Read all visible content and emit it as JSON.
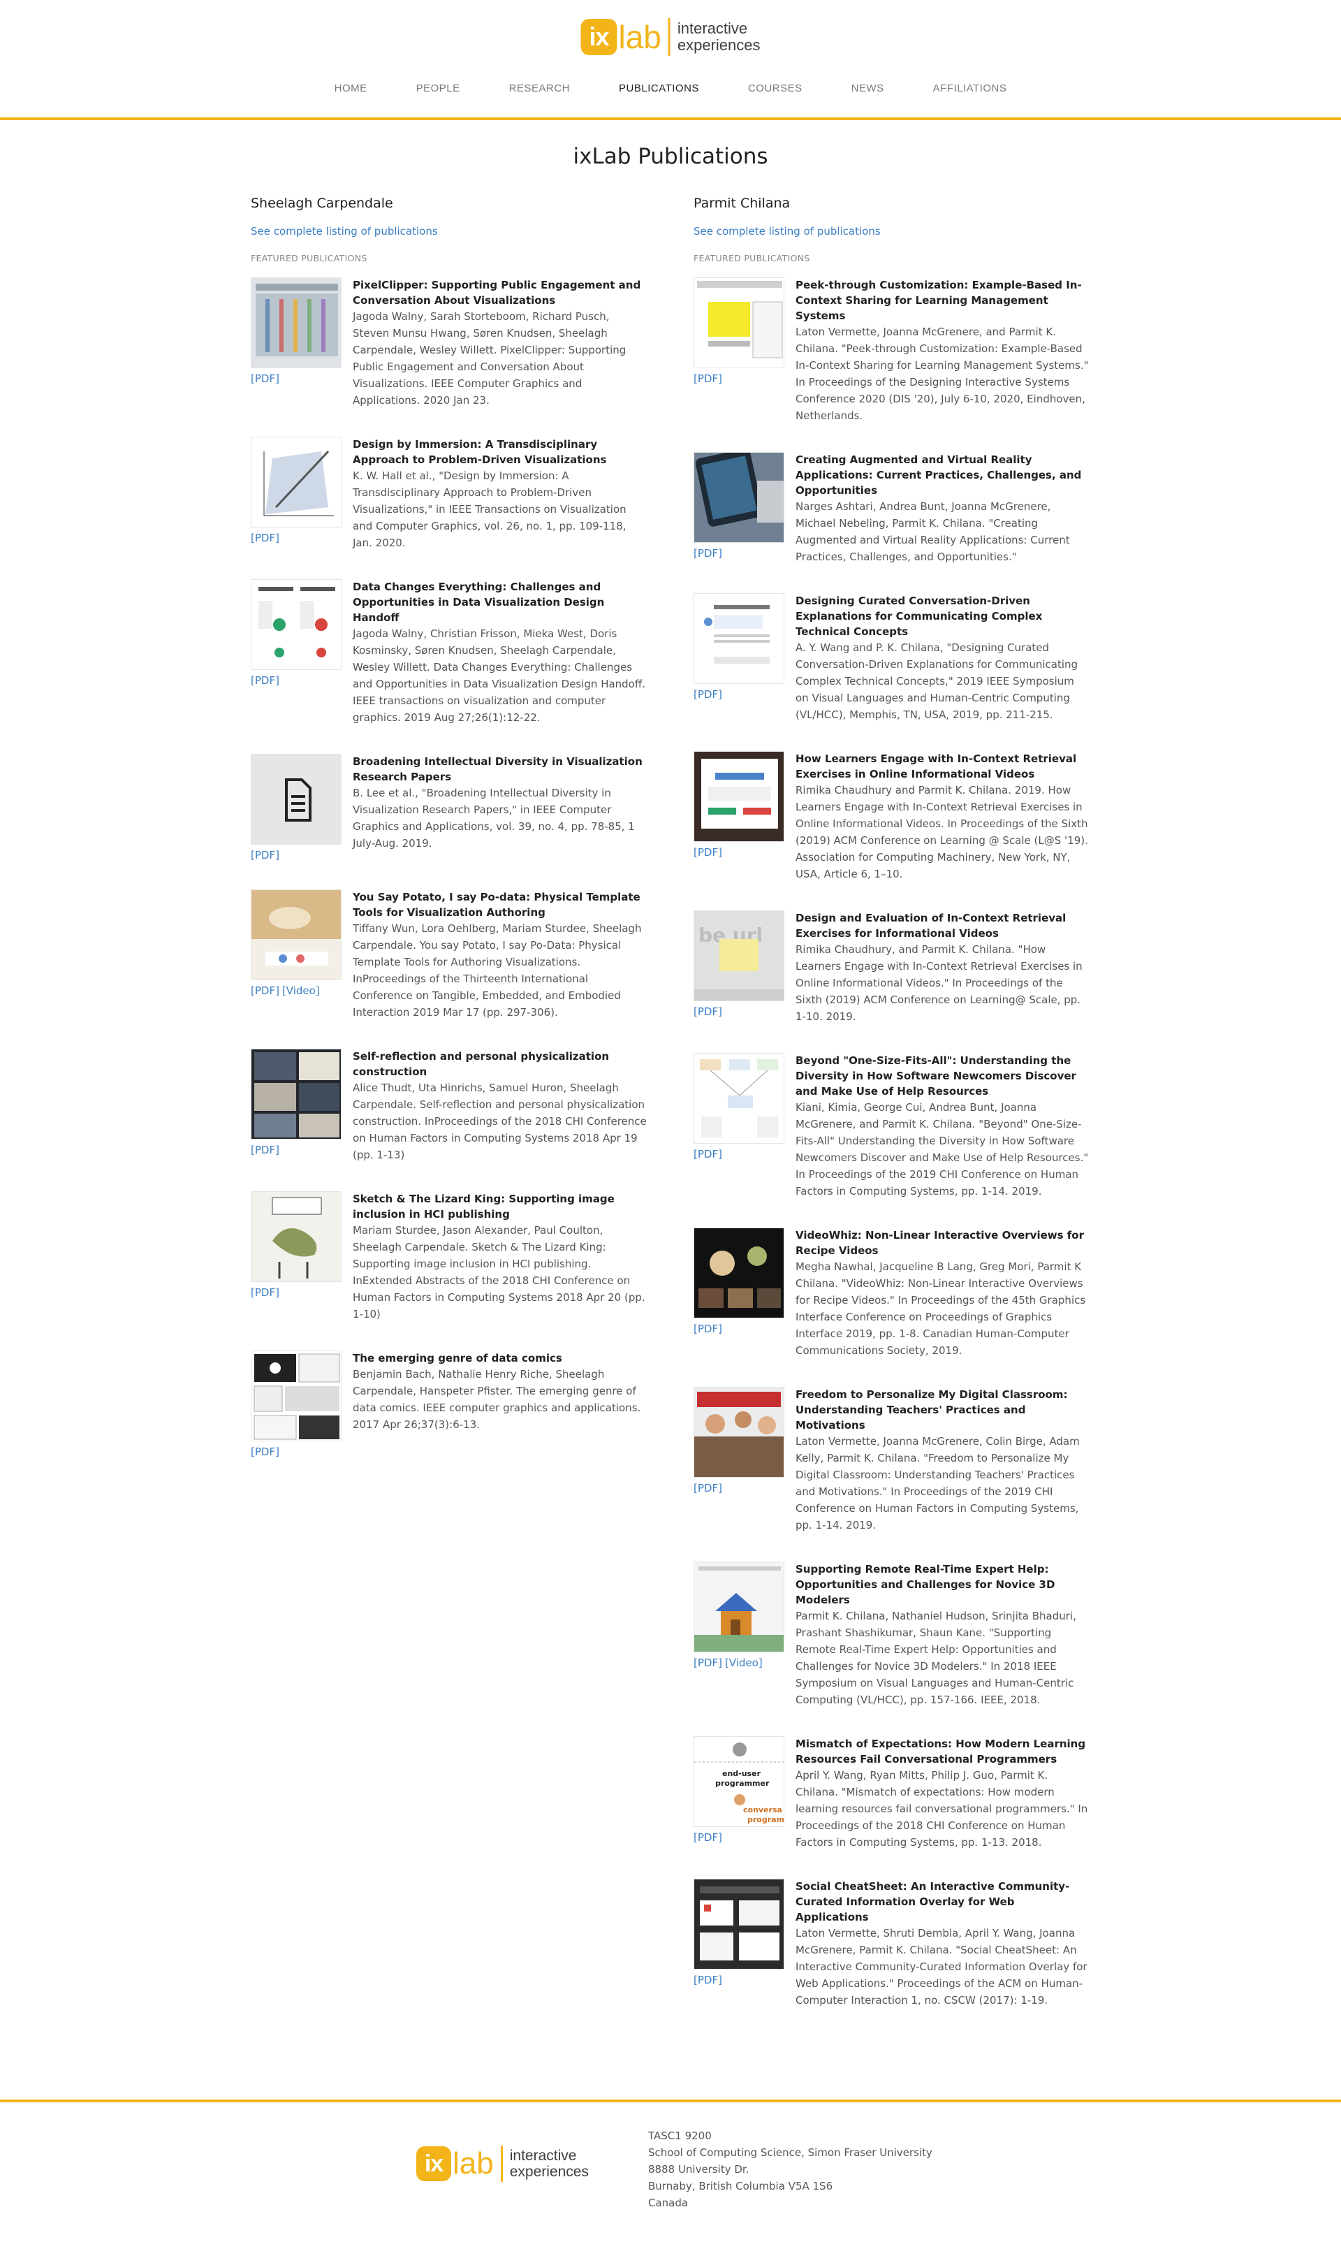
{
  "header": {
    "logo_ix": "ix",
    "logo_lab": "lab",
    "logo_tag1": "interactive",
    "logo_tag2": "experiences",
    "nav": [
      "HOME",
      "PEOPLE",
      "RESEARCH",
      "PUBLICATIONS",
      "COURSES",
      "NEWS",
      "AFFILIATIONS"
    ],
    "active_nav": "PUBLICATIONS"
  },
  "page_title": "ixLab Publications",
  "left": {
    "name": "Sheelagh Carpendale",
    "link": "See complete listing of publications",
    "featured": "FEATURED PUBLICATIONS",
    "pubs": [
      {
        "title": "PixelClipper: Supporting Public Engagement and Conversation About Visualizations",
        "desc": "Jagoda Walny, Sarah Storteboom, Richard Pusch, Steven Munsu Hwang, Søren Knudsen, Sheelagh Carpendale, Wesley Willett. PixelClipper: Supporting Public Engagement and Conversation About Visualizations. IEEE Computer Graphics and Applications. 2020 Jan 23.",
        "pdf": "[PDF]",
        "video": ""
      },
      {
        "title": "Design by Immersion: A Transdisciplinary Approach to Problem-Driven Visualizations",
        "desc": "K. W. Hall et al., \"Design by Immersion: A Transdisciplinary Approach to Problem-Driven Visualizations,\" in IEEE Transactions on Visualization and Computer Graphics, vol. 26, no. 1, pp. 109-118, Jan. 2020.",
        "pdf": "[PDF]",
        "video": ""
      },
      {
        "title": "Data Changes Everything: Challenges and Opportunities in Data Visualization Design Handoff",
        "desc": "Jagoda Walny, Christian Frisson, Mieka West, Doris Kosminsky, Søren Knudsen, Sheelagh Carpendale, Wesley Willett. Data Changes Everything: Challenges and Opportunities in Data Visualization Design Handoff. IEEE transactions on visualization and computer graphics. 2019 Aug 27;26(1):12-22.",
        "pdf": "[PDF]",
        "video": ""
      },
      {
        "title": "Broadening Intellectual Diversity in Visualization Research Papers",
        "desc": "B. Lee et al., \"Broadening Intellectual Diversity in Visualization Research Papers,\" in IEEE Computer Graphics and Applications, vol. 39, no. 4, pp. 78-85, 1 July-Aug. 2019.",
        "pdf": "[PDF]",
        "video": ""
      },
      {
        "title": "You Say Potato, I say Po-data: Physical Template Tools for Visualization Authoring",
        "desc": "Tiffany Wun, Lora Oehlberg, Mariam Sturdee, Sheelagh Carpendale. You say Potato, I say Po-Data: Physical Template Tools for Authoring Visualizations. InProceedings of the Thirteenth International Conference on Tangible, Embedded, and Embodied Interaction 2019 Mar 17 (pp. 297-306).",
        "pdf": "[PDF]",
        "video": "[Video]"
      },
      {
        "title": "Self-reflection and personal physicalization construction",
        "desc": "Alice Thudt, Uta Hinrichs, Samuel Huron, Sheelagh Carpendale. Self-reflection and personal physicalization construction. InProceedings of the 2018 CHI Conference on Human Factors in Computing Systems 2018 Apr 19 (pp. 1-13)",
        "pdf": "[PDF]",
        "video": ""
      },
      {
        "title": "Sketch & The Lizard King: Supporting image inclusion in HCI publishing",
        "desc": "Mariam Sturdee, Jason Alexander, Paul Coulton, Sheelagh Carpendale. Sketch & The Lizard King: Supporting image inclusion in HCI publishing. InExtended Abstracts of the 2018 CHI Conference on Human Factors in Computing Systems 2018 Apr 20 (pp. 1-10)",
        "pdf": "[PDF]",
        "video": ""
      },
      {
        "title": "The emerging genre of data comics",
        "desc": "Benjamin Bach, Nathalie Henry Riche, Sheelagh Carpendale, Hanspeter Pfister. The emerging genre of data comics. IEEE computer graphics and applications. 2017 Apr 26;37(3):6-13.",
        "pdf": "[PDF]",
        "video": ""
      }
    ]
  },
  "right": {
    "name": "Parmit Chilana",
    "link": "See complete listing of publications",
    "featured": "FEATURED PUBLICATIONS",
    "pubs": [
      {
        "title": "Peek-through Customization: Example-Based In-Context Sharing for Learning Management Systems",
        "desc": "Laton Vermette, Joanna McGrenere, and Parmit K. Chilana. \"Peek-through Customization: Example-Based In-Context Sharing for Learning Management Systems.\" In Proceedings of the Designing Interactive Systems Conference 2020 (DIS '20), July 6-10, 2020, Eindhoven, Netherlands.",
        "pdf": "[PDF]",
        "video": ""
      },
      {
        "title": "Creating Augmented and Virtual Reality Applications: Current Practices, Challenges, and Opportunities",
        "desc": "Narges Ashtari, Andrea Bunt, Joanna McGrenere, Michael Nebeling, Parmit K. Chilana. \"Creating Augmented and Virtual Reality Applications: Current Practices, Challenges, and Opportunities.\"",
        "pdf": "[PDF]",
        "video": ""
      },
      {
        "title": "Designing Curated Conversation-Driven Explanations for Communicating Complex Technical Concepts",
        "desc": "A. Y. Wang and P. K. Chilana, \"Designing Curated Conversation-Driven Explanations for Communicating Complex Technical Concepts,\" 2019 IEEE Symposium on Visual Languages and Human-Centric Computing (VL/HCC), Memphis, TN, USA, 2019, pp. 211-215.",
        "pdf": "[PDF]",
        "video": ""
      },
      {
        "title": "How Learners Engage with In-Context Retrieval Exercises in Online Informational Videos",
        "desc": "Rimika Chaudhury and Parmit K. Chilana. 2019. How Learners Engage with In-Context Retrieval Exercises in Online Informational Videos. In Proceedings of the Sixth (2019) ACM Conference on Learning @ Scale (L@S '19). Association for Computing Machinery, New York, NY, USA, Article 6, 1–10.",
        "pdf": "[PDF]",
        "video": ""
      },
      {
        "title": "Design and Evaluation of In-Context Retrieval Exercises for Informational Videos",
        "desc": "Rimika Chaudhury, and Parmit K. Chilana. \"How Learners Engage with In-Context Retrieval Exercises in Online Informational Videos.\" In Proceedings of the Sixth (2019) ACM Conference on Learning@ Scale, pp. 1-10. 2019.",
        "pdf": "[PDF]",
        "video": ""
      },
      {
        "title": "Beyond \"One-Size-Fits-All\": Understanding the Diversity in How Software Newcomers Discover and Make Use of Help Resources",
        "desc": "Kiani, Kimia, George Cui, Andrea Bunt, Joanna McGrenere, and Parmit K. Chilana. \"Beyond\" One-Size-Fits-All\" Understanding the Diversity in How Software Newcomers Discover and Make Use of Help Resources.\" In Proceedings of the 2019 CHI Conference on Human Factors in Computing Systems, pp. 1-14. 2019.",
        "pdf": "[PDF]",
        "video": ""
      },
      {
        "title": "VideoWhiz: Non-Linear Interactive Overviews for Recipe Videos",
        "desc": "Megha Nawhal, Jacqueline B Lang, Greg Mori, Parmit K Chilana. \"VideoWhiz: Non-Linear Interactive Overviews for Recipe Videos.\" In Proceedings of the 45th Graphics Interface Conference on Proceedings of Graphics Interface 2019, pp. 1-8. Canadian Human-Computer Communications Society, 2019.",
        "pdf": "[PDF]",
        "video": ""
      },
      {
        "title": "Freedom to Personalize My Digital Classroom: Understanding Teachers' Practices and Motivations",
        "desc": "Laton Vermette, Joanna McGrenere, Colin Birge, Adam Kelly, Parmit K. Chilana. \"Freedom to Personalize My Digital Classroom: Understanding Teachers' Practices and Motivations.\" In Proceedings of the 2019 CHI Conference on Human Factors in Computing Systems, pp. 1-14. 2019.",
        "pdf": "[PDF]",
        "video": ""
      },
      {
        "title": "Supporting Remote Real-Time Expert Help: Opportunities and Challenges for Novice 3D Modelers",
        "desc": "Parmit K. Chilana, Nathaniel Hudson, Srinjita Bhaduri, Prashant Shashikumar, Shaun Kane. \"Supporting Remote Real-Time Expert Help: Opportunities and Challenges for Novice 3D Modelers.\" In 2018 IEEE Symposium on Visual Languages and Human-Centric Computing (VL/HCC), pp. 157-166. IEEE, 2018.",
        "pdf": "[PDF]",
        "video": "[Video]"
      },
      {
        "title": "Mismatch of Expectations: How Modern Learning Resources Fail Conversational Programmers",
        "desc": "April Y. Wang, Ryan Mitts, Philip J. Guo, Parmit K. Chilana. \"Mismatch of expectations: How modern learning resources fail conversational programmers.\" In Proceedings of the 2018 CHI Conference on Human Factors in Computing Systems, pp. 1-13. 2018.",
        "pdf": "[PDF]",
        "video": ""
      },
      {
        "title": "Social CheatSheet: An Interactive Community-Curated Information Overlay for Web Applications",
        "desc": "Laton Vermette, Shruti Dembla, April Y. Wang, Joanna McGrenere, Parmit K. Chilana. \"Social CheatSheet: An Interactive Community-Curated Information Overlay for Web Applications.\" Proceedings of the ACM on Human-Computer Interaction 1, no. CSCW (2017): 1-19.",
        "pdf": "[PDF]",
        "video": ""
      }
    ]
  },
  "thumb_text": {
    "mismatch_1": "end-user",
    "mismatch_2": "programmer",
    "mismatch_3": "conversa",
    "mismatch_4": "program",
    "beurl": "be     url"
  },
  "footer": {
    "address": [
      "TASC1 9200",
      "School of Computing Science, Simon Fraser University",
      "8888 University Dr.",
      "Burnaby, British Columbia V5A 1S6",
      "Canada"
    ]
  },
  "colors": {
    "accent": "#f2b418",
    "link": "#3b7fc4"
  }
}
